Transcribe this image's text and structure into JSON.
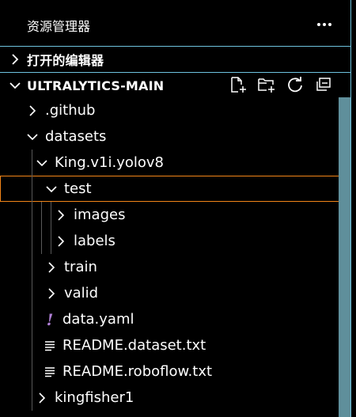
{
  "panel": {
    "title": "资源管理器"
  },
  "sections": {
    "open_editors": "打开的编辑器",
    "workspace": "ULTRALYTICS-MAIN"
  },
  "toolbar": {
    "icons": [
      "new-file-icon",
      "new-folder-icon",
      "refresh-icon",
      "collapse-all-icon"
    ]
  },
  "tree": [
    {
      "label": ".github",
      "type": "folder",
      "expanded": false,
      "depth": 0
    },
    {
      "label": "datasets",
      "type": "folder",
      "expanded": true,
      "depth": 0
    },
    {
      "label": "King.v1i.yolov8",
      "type": "folder",
      "expanded": true,
      "depth": 1
    },
    {
      "label": "test",
      "type": "folder",
      "expanded": true,
      "depth": 2,
      "selected": true
    },
    {
      "label": "images",
      "type": "folder",
      "expanded": false,
      "depth": 3
    },
    {
      "label": "labels",
      "type": "folder",
      "expanded": false,
      "depth": 3
    },
    {
      "label": "train",
      "type": "folder",
      "expanded": false,
      "depth": 2
    },
    {
      "label": "valid",
      "type": "folder",
      "expanded": false,
      "depth": 2
    },
    {
      "label": "data.yaml",
      "type": "yaml",
      "depth": 2
    },
    {
      "label": "README.dataset.txt",
      "type": "text",
      "depth": 2
    },
    {
      "label": "README.roboflow.txt",
      "type": "text",
      "depth": 2
    },
    {
      "label": "kingfisher1",
      "type": "folder",
      "expanded": false,
      "depth": 1
    }
  ],
  "colors": {
    "background": "#000000",
    "contrast_border": "#6fc3df",
    "focus_outline": "#f38518",
    "scrollbar": "#5f8f9b",
    "yaml_icon": "#b180d7"
  }
}
